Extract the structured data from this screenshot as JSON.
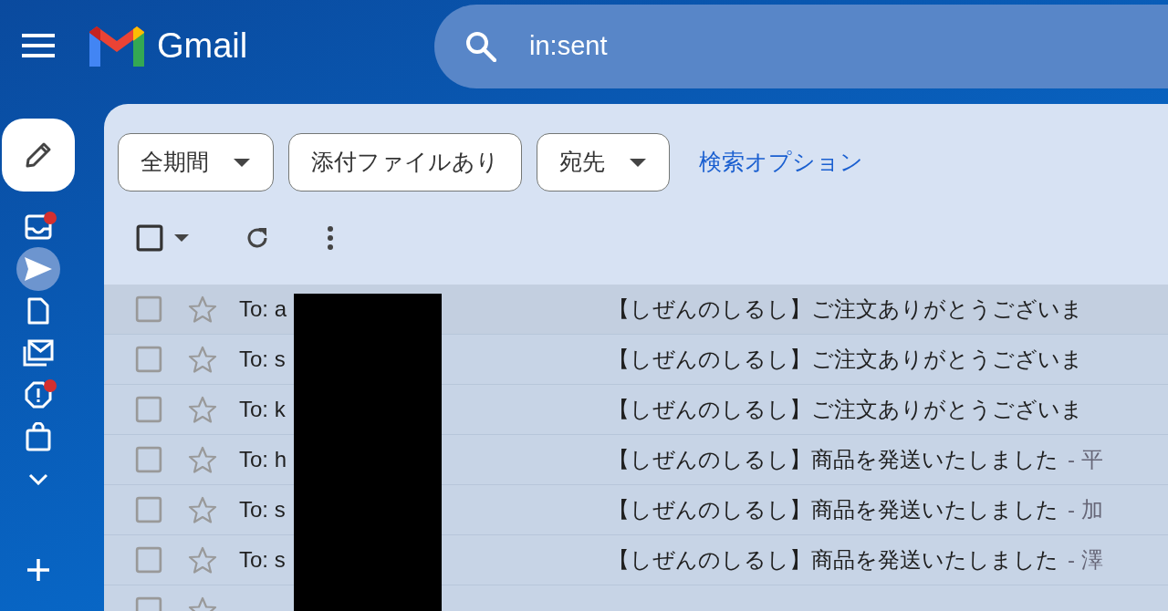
{
  "header": {
    "app_name": "Gmail",
    "search": {
      "value": "in:sent"
    }
  },
  "rail": {
    "items": [
      {
        "selected": false,
        "dot": true
      },
      {
        "selected": true,
        "dot": false
      },
      {
        "selected": false,
        "dot": false
      },
      {
        "selected": false,
        "dot": false
      },
      {
        "selected": false,
        "dot": true
      },
      {
        "selected": false,
        "dot": false
      }
    ]
  },
  "filters": [
    {
      "label": "全期間",
      "dropdown": true
    },
    {
      "label": "添付ファイルあり",
      "dropdown": false
    },
    {
      "label": "宛先",
      "dropdown": true
    }
  ],
  "search_options_link": "検索オプション",
  "toolbar": {
    "select_all_checked": false
  },
  "messages": [
    {
      "recipient": "To: a",
      "subject": "【しぜんのしるし】ご注文ありがとうございま",
      "checked": false,
      "starred": false
    },
    {
      "recipient": "To: s",
      "subject": "【しぜんのしるし】ご注文ありがとうございま",
      "checked": false,
      "starred": false
    },
    {
      "recipient": "To: k",
      "subject": "【しぜんのしるし】ご注文ありがとうございま",
      "checked": false,
      "starred": false
    },
    {
      "recipient": "To: h",
      "subject": "【しぜんのしるし】商品を発送いたしました",
      "snippet": "- 平",
      "checked": false,
      "starred": false
    },
    {
      "recipient": "To: s",
      "subject": "【しぜんのしるし】商品を発送いたしました",
      "snippet": "- 加",
      "checked": false,
      "starred": false
    },
    {
      "recipient": "To: s",
      "subject": "【しぜんのしるし】商品を発送いたしました",
      "snippet": "- 澤",
      "checked": false,
      "starred": false
    },
    {
      "checked": false,
      "starred": false
    }
  ]
}
